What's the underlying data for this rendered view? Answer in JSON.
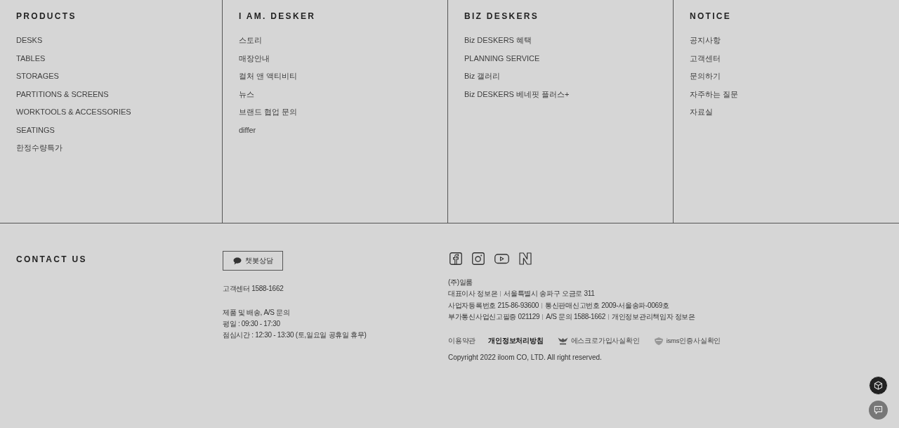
{
  "menu_columns": [
    {
      "heading": "PRODUCTS",
      "items": [
        "DESKS",
        "TABLES",
        "STORAGES",
        "PARTITIONS & SCREENS",
        "WORKTOOLS & ACCESSORIES",
        "SEATINGS",
        "한정수량특가"
      ]
    },
    {
      "heading": "I AM. DESKER",
      "items": [
        "스토리",
        "매장안내",
        "컬처 앤 액티비티",
        "뉴스",
        "브랜드 협업 문의",
        "differ"
      ]
    },
    {
      "heading": "BIZ DESKERS",
      "items": [
        "Biz DESKERS 혜택",
        "PLANNING SERVICE",
        "Biz 갤러리",
        "Biz DESKERS 베네핏 플러스+"
      ]
    },
    {
      "heading": "NOTICE",
      "items": [
        "공지사항",
        "고객센터",
        "문의하기",
        "자주하는 질문",
        "자료실"
      ]
    }
  ],
  "contact": {
    "heading": "CONTACT US",
    "chat_button": "챗봇상담",
    "phone": "고객센터 1588-1662",
    "hours": [
      "제품 및 배송, A/S 문의",
      "평일 : 09:30 - 17:30",
      "점심시간 : 12:30 - 13:30 (토,일요일 공휴일 휴무)"
    ]
  },
  "company": {
    "lines": [
      [
        "(주)일룸"
      ],
      [
        "대표이사 정보은",
        "서울특별시 송파구 오금로 311"
      ],
      [
        "사업자등록번호 215-86-93600",
        "통신판매신고번호 2009-서울송파-0069호"
      ],
      [
        "부가통신사업신고필증 021129",
        "A/S 문의 1588-1662",
        "개인정보관리책임자 정보은"
      ]
    ],
    "links": [
      {
        "label": "이용약관",
        "kind": "plain"
      },
      {
        "label": "개인정보처리방침",
        "kind": "strong"
      },
      {
        "label": "에스크로가입사실확인",
        "kind": "escrow"
      },
      {
        "label": "isms인증사실확인",
        "kind": "certificate"
      }
    ],
    "copyright": "Copyright 2022 iloom CO, LTD. All right reserved."
  }
}
